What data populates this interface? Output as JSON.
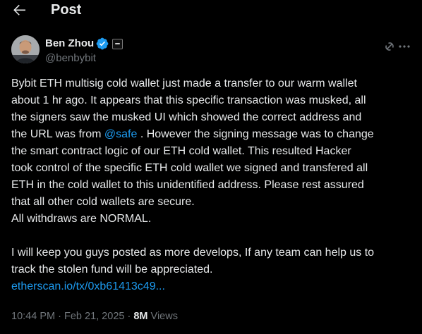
{
  "header": {
    "title": "Post",
    "back_icon": "arrow-left-icon"
  },
  "author": {
    "display_name": "Ben Zhou",
    "handle": "@benbybit",
    "verified_color": "#1d9bf0"
  },
  "tweet": {
    "line1": "Bybit ETH multisig cold wallet just made a transfer to our warm wallet",
    "line2": "about 1 hr ago. It appears that this specific transaction was musked, all",
    "line3": "the signers saw the musked UI which showed the correct address and",
    "line4_before": "the URL was from ",
    "line4_mention": "@safe",
    "line4_after": " . However the signing message was to change",
    "line5": "the smart contract logic of our ETH cold wallet. This resulted Hacker",
    "line6": "took control of the specific ETH cold wallet we signed and transfered all",
    "line7": "ETH in the cold wallet to this unidentified address. Please rest assured",
    "line8": "that all other cold wallets are secure.",
    "line9": "All withdraws are NORMAL.",
    "line10": "I will keep you guys posted as more develops, If any team can help us to",
    "line11": "track the stolen fund will be appreciated.",
    "link": "etherscan.io/tx/0xb61413c49..."
  },
  "meta": {
    "time": "10:44 PM",
    "separator": "·",
    "date": "Feb 21, 2025",
    "views_count": "8M",
    "views_label": "Views"
  },
  "colors": {
    "background": "#000000",
    "text": "#e7e9ea",
    "secondary": "#71767b",
    "accent": "#1d9bf0"
  }
}
